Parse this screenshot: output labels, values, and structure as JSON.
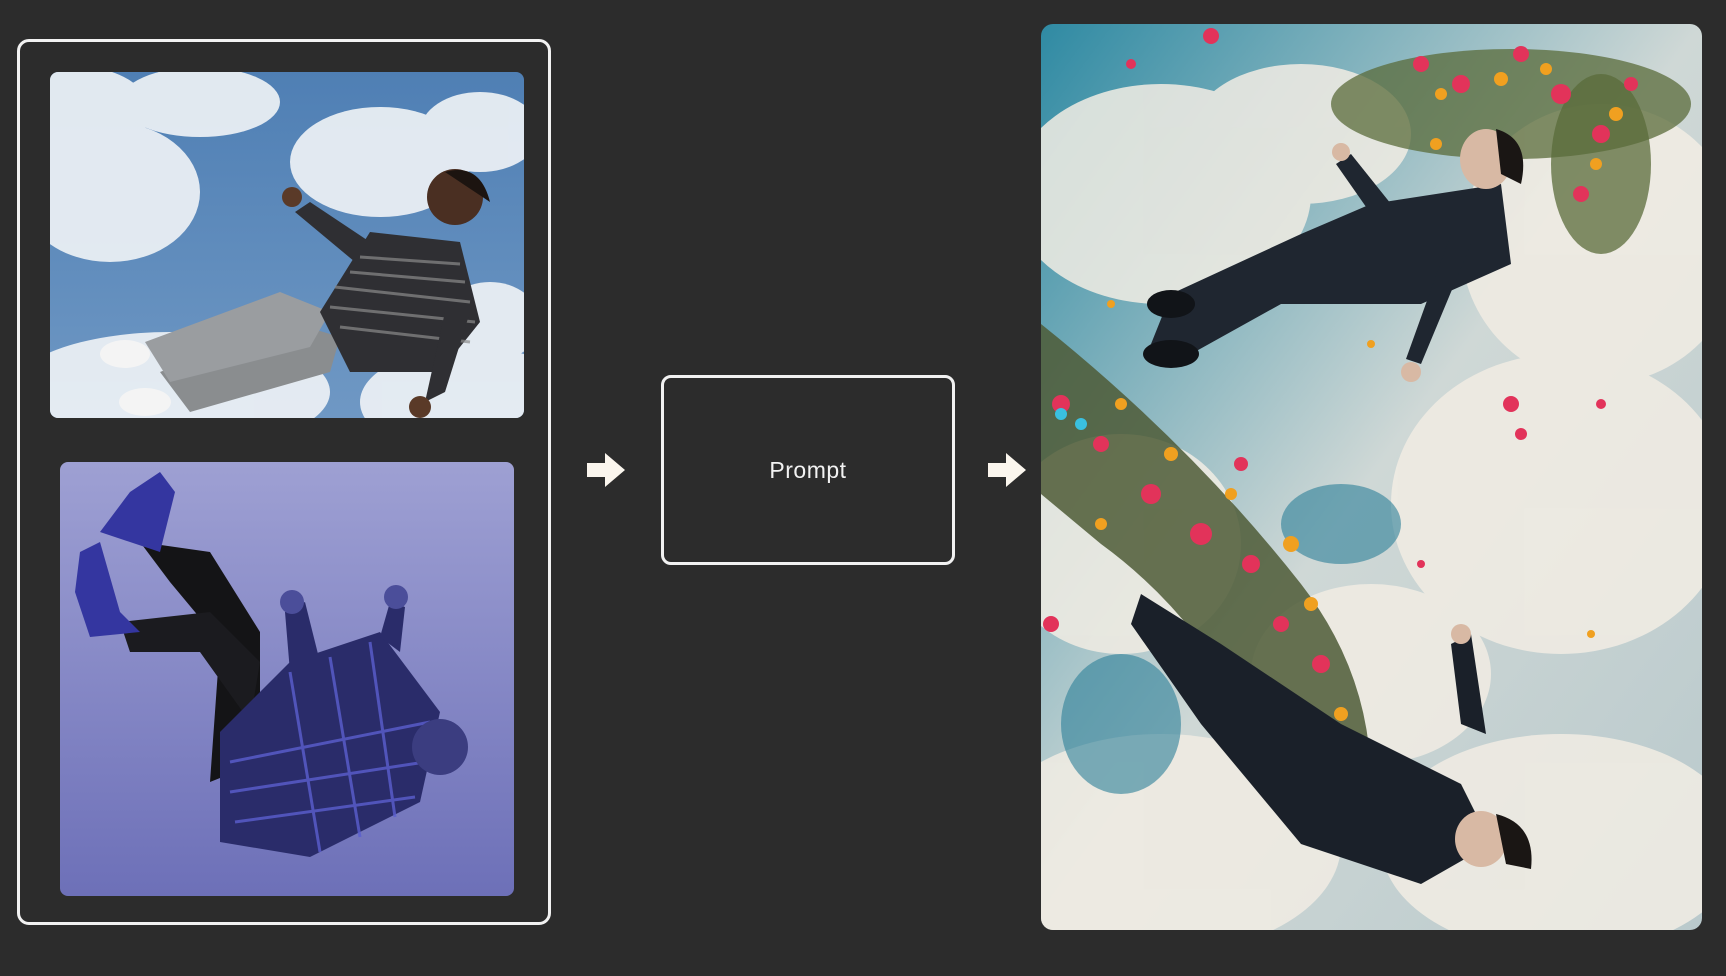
{
  "prompt": {
    "label": "Prompt"
  },
  "images": {
    "top_input": "man-falling-blue-sky-photo",
    "bottom_input": "man-falling-purple-backdrop-photo",
    "output": "two-men-falling-sky-flowers-photo"
  },
  "icons": {
    "arrow_1": "right-arrow-icon",
    "arrow_2": "right-arrow-icon"
  },
  "colors": {
    "background": "#2c2c2c",
    "frame": "#f2f2f2",
    "sky_blue": "#5b86b5",
    "lavender": "#9a9cd0",
    "output_sky": "#3f8aa0"
  }
}
